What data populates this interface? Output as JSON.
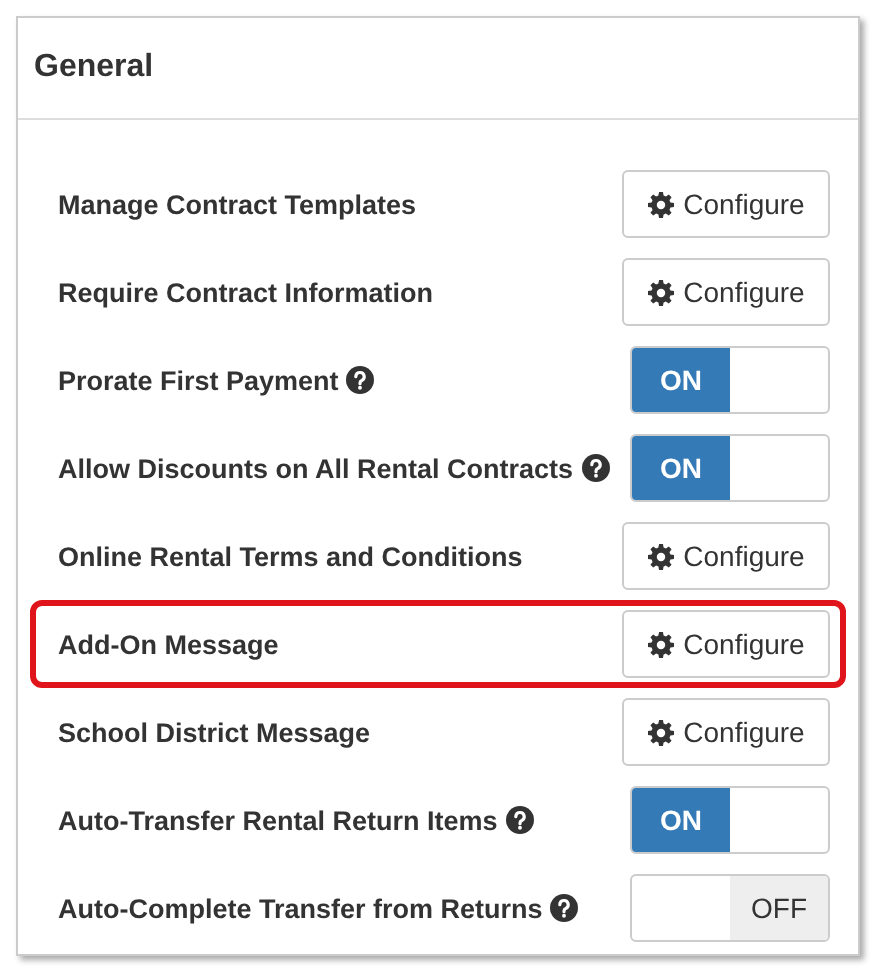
{
  "panel": {
    "title": "General"
  },
  "settings": [
    {
      "label": "Manage Contract Templates",
      "kind": "configure",
      "button": "Configure",
      "help": false,
      "highlighted": false
    },
    {
      "label": "Require Contract Information",
      "kind": "configure",
      "button": "Configure",
      "help": false,
      "highlighted": false
    },
    {
      "label": "Prorate First Payment",
      "kind": "toggle",
      "on": true,
      "toggle_label": "ON",
      "help": true,
      "highlighted": false
    },
    {
      "label": "Allow Discounts on All Rental Contracts",
      "kind": "toggle",
      "on": true,
      "toggle_label": "ON",
      "help": true,
      "highlighted": false
    },
    {
      "label": "Online Rental Terms and Conditions",
      "kind": "configure",
      "button": "Configure",
      "help": false,
      "highlighted": false
    },
    {
      "label": "Add-On Message",
      "kind": "configure",
      "button": "Configure",
      "help": false,
      "highlighted": true
    },
    {
      "label": "School District Message",
      "kind": "configure",
      "button": "Configure",
      "help": false,
      "highlighted": false
    },
    {
      "label": "Auto-Transfer Rental Return Items",
      "kind": "toggle",
      "on": true,
      "toggle_label": "ON",
      "help": true,
      "highlighted": false
    },
    {
      "label": "Auto-Complete Transfer from Returns",
      "kind": "toggle",
      "on": false,
      "toggle_label": "OFF",
      "help": true,
      "highlighted": false
    }
  ]
}
